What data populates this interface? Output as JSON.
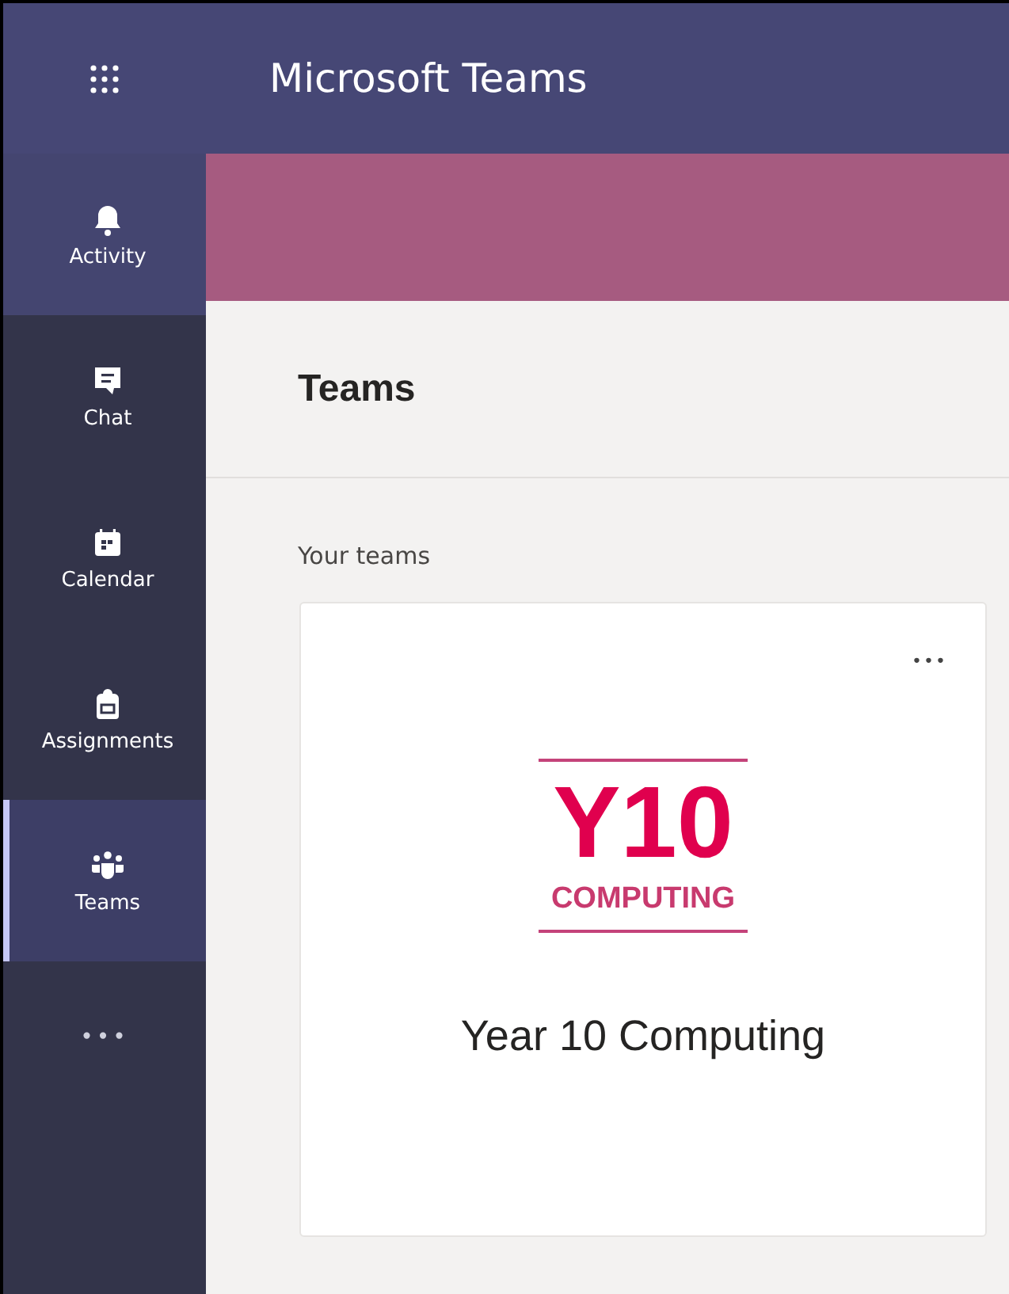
{
  "window": {
    "title": "Microsoft Teams"
  },
  "rail": {
    "items": [
      {
        "kind": "activity",
        "label": "Activity",
        "selected": false,
        "highlighted": true
      },
      {
        "kind": "chat",
        "label": "Chat",
        "selected": false,
        "highlighted": false
      },
      {
        "kind": "calendar",
        "label": "Calendar",
        "selected": false,
        "highlighted": false
      },
      {
        "kind": "assignments",
        "label": "Assignments",
        "selected": false,
        "highlighted": false
      },
      {
        "kind": "teams",
        "label": "Teams",
        "selected": true,
        "highlighted": false
      }
    ],
    "more": "•••"
  },
  "page": {
    "title": "Teams",
    "section": "Your teams"
  },
  "teams": [
    {
      "logo_title": "Y10",
      "logo_subtitle": "COMPUTING",
      "name": "Year 10 Computing",
      "menu": "•••"
    }
  ]
}
